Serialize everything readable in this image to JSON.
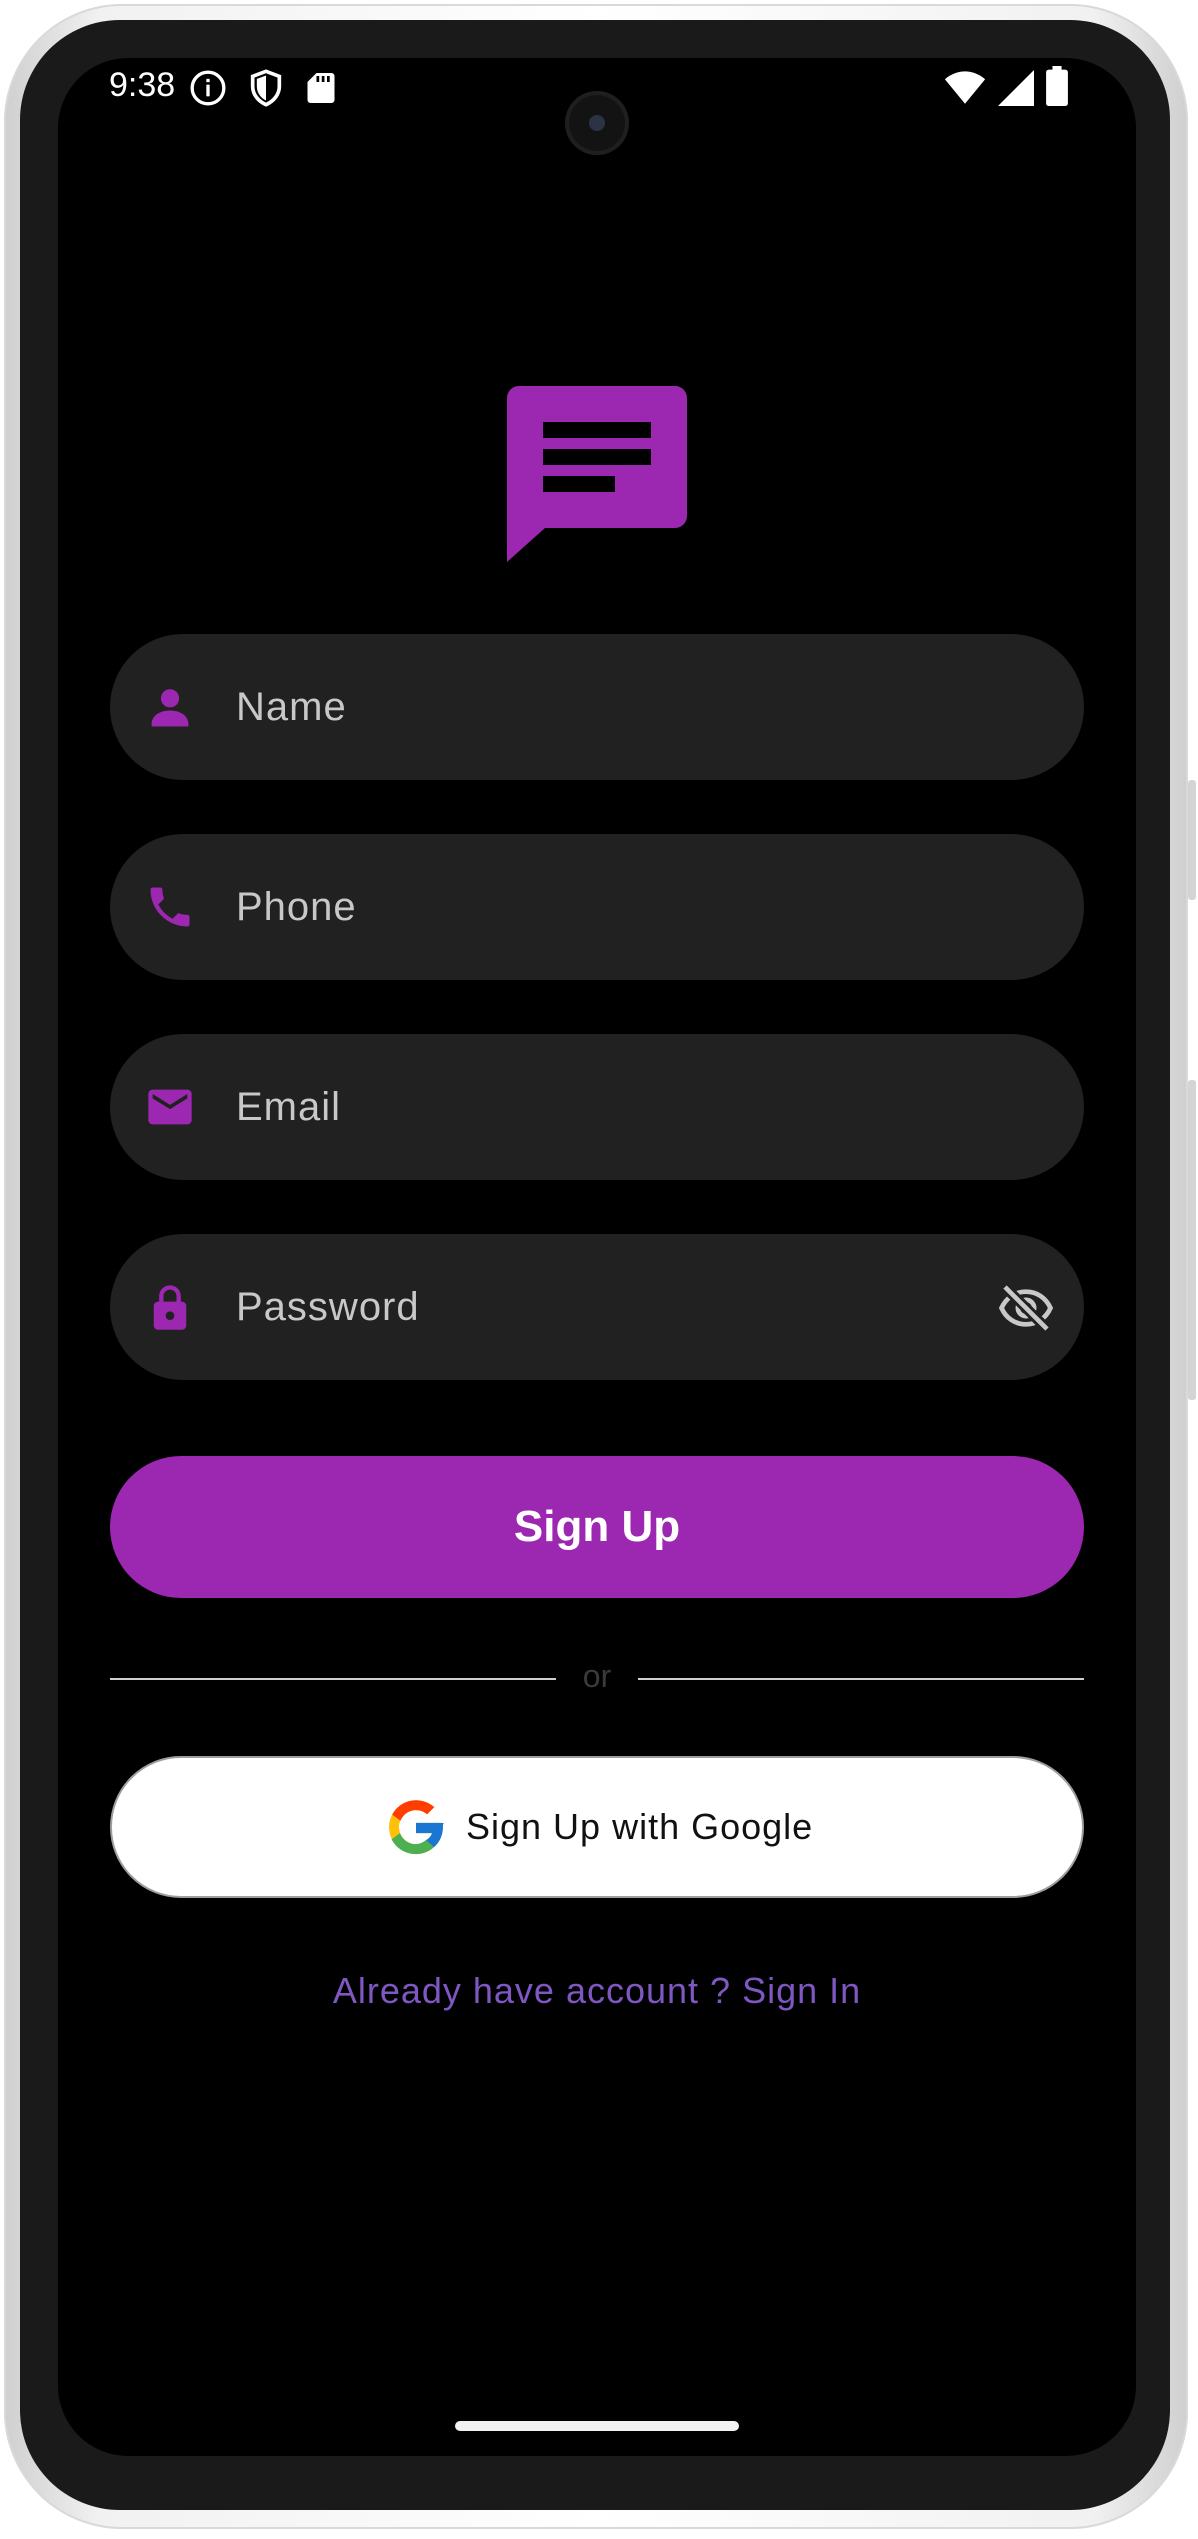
{
  "status_bar": {
    "time": "9:38",
    "left_icons": [
      "info-icon",
      "shield-icon",
      "sd-card-icon"
    ],
    "right_icons": [
      "wifi-icon",
      "signal-icon",
      "battery-icon"
    ]
  },
  "logo": {
    "icon": "chat-bubble-icon",
    "color": "#9c27b0"
  },
  "form": {
    "name": {
      "placeholder": "Name",
      "icon": "person-icon"
    },
    "phone": {
      "placeholder": "Phone",
      "icon": "phone-icon"
    },
    "email": {
      "placeholder": "Email",
      "icon": "email-icon"
    },
    "password": {
      "placeholder": "Password",
      "icon": "lock-icon",
      "toggle_icon": "visibility-off-icon"
    }
  },
  "buttons": {
    "sign_up": "Sign Up",
    "divider": "or",
    "google": "Sign Up with Google"
  },
  "footer": {
    "signin_link": "Already have account ? Sign In"
  },
  "colors": {
    "accent": "#9c27b0",
    "field_bg": "#212121",
    "background": "#000000",
    "link": "#7e57c2"
  }
}
